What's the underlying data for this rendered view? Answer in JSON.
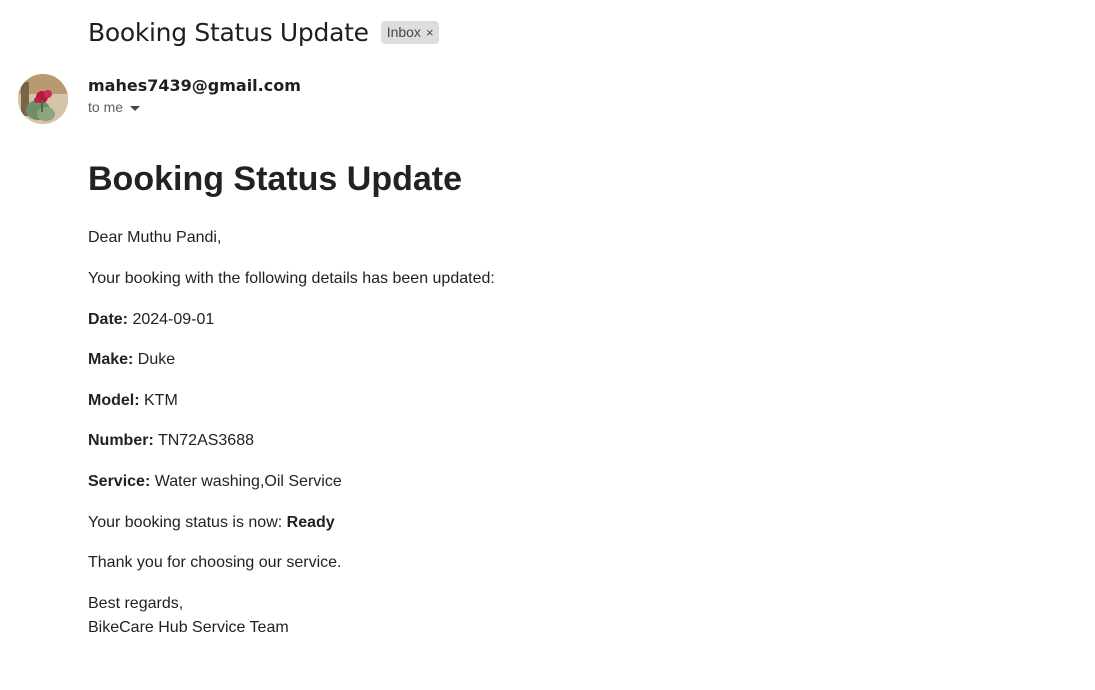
{
  "email": {
    "subject": "Booking Status Update",
    "label": "Inbox",
    "label_remove": "×",
    "sender": "mahes7439@gmail.com",
    "recipient": "to me"
  },
  "content": {
    "heading": "Booking Status Update",
    "greeting": "Dear Muthu Pandi,",
    "intro": "Your booking with the following details has been updated:",
    "details": [
      {
        "label": "Date:",
        "value": " 2024-09-01"
      },
      {
        "label": "Make:",
        "value": " Duke"
      },
      {
        "label": "Model:",
        "value": " KTM"
      },
      {
        "label": "Number:",
        "value": " TN72AS3688"
      },
      {
        "label": "Service:",
        "value": " Water washing,Oil Service"
      }
    ],
    "status_prefix": "Your booking status is now: ",
    "status_value": "Ready",
    "thanks": "Thank you for choosing our service.",
    "sign_off": "Best regards,",
    "team": "BikeCare Hub Service Team"
  },
  "colors": {
    "chip_background": "#dddddd",
    "text": "#222222"
  }
}
